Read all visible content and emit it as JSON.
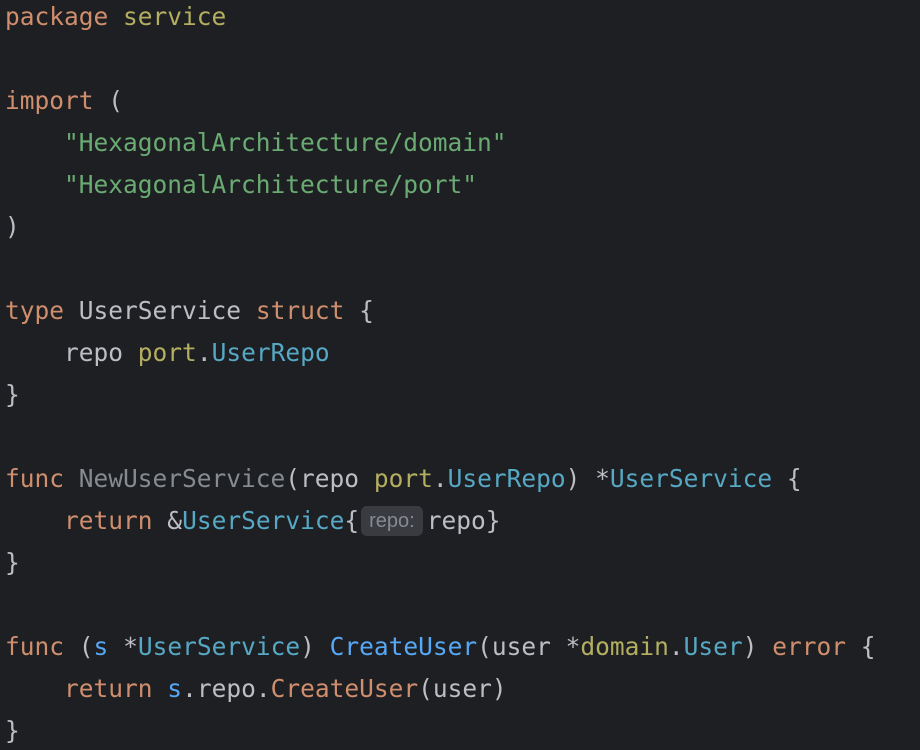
{
  "code": {
    "l1": {
      "kw": "package",
      "name": "service"
    },
    "l3": {
      "kw": "import",
      "paren": "("
    },
    "l4": {
      "indent": "    ",
      "str": "\"HexagonalArchitecture/domain\""
    },
    "l5": {
      "indent": "    ",
      "str": "\"HexagonalArchitecture/port\""
    },
    "l6": {
      "paren": ")"
    },
    "l8": {
      "kw": "type",
      "name": "UserService",
      "kw2": "struct",
      "brace": "{"
    },
    "l9": {
      "indent": "    ",
      "field": "repo",
      "pkg": "port",
      "dot": ".",
      "type": "UserRepo"
    },
    "l10": {
      "brace": "}"
    },
    "l12": {
      "kw": "func",
      "name": "NewUserService",
      "open": "(repo ",
      "pkg": "port",
      "dot": ".",
      "type": "UserRepo",
      "close": ") *",
      "ret": "UserService",
      "brace": "{"
    },
    "l13": {
      "indent": "    ",
      "kw": "return",
      "amp": "&",
      "type": "UserService",
      "open": "{",
      "hint": "repo:",
      "rest": "repo}"
    },
    "l14": {
      "brace": "}"
    },
    "l16": {
      "kw": "func",
      "open": "(",
      "recv": "s",
      "star": " *",
      "type": "UserService",
      "close": ") ",
      "name": "CreateUser",
      "params": "(user *",
      "pkg": "domain",
      "dot": ".",
      "ptype": "User",
      "pclose": ") ",
      "ret": "error",
      "brace": "{"
    },
    "l17": {
      "indent": "    ",
      "kw": "return",
      "recv": "s",
      "mid": ".repo.",
      "call": "CreateUser",
      "args": "(user)"
    },
    "l18": {
      "brace": "}"
    }
  }
}
